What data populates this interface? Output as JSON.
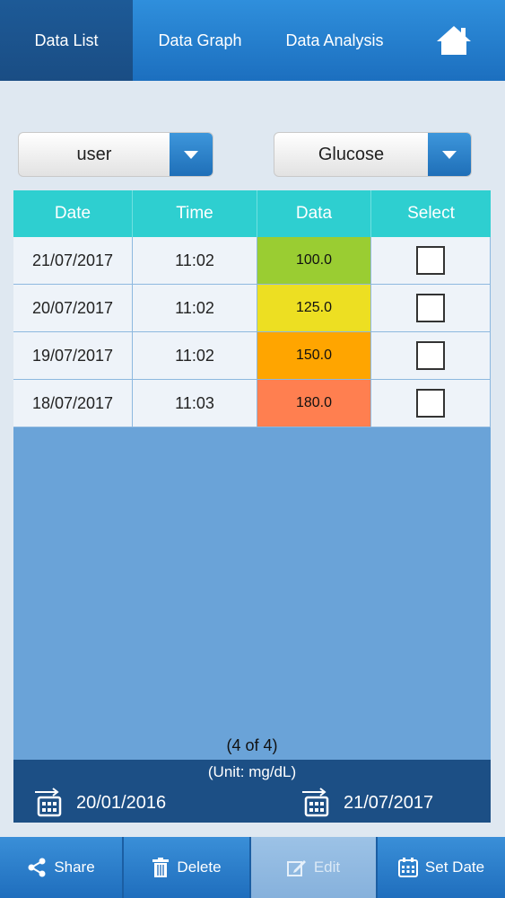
{
  "nav": {
    "tabs": [
      {
        "label": "Data List",
        "active": true
      },
      {
        "label": "Data Graph",
        "active": false
      },
      {
        "label": "Data Analysis",
        "active": false
      }
    ],
    "home_icon": "home-icon"
  },
  "filters": {
    "user": "user",
    "measure": "Glucose"
  },
  "table": {
    "headers": [
      "Date",
      "Time",
      "Data",
      "Select"
    ],
    "rows": [
      {
        "date": "21/07/2017",
        "time": "11:02",
        "value": "100.0",
        "color": "#9acd32"
      },
      {
        "date": "20/07/2017",
        "time": "11:02",
        "value": "125.0",
        "color": "#eddf22"
      },
      {
        "date": "19/07/2017",
        "time": "11:02",
        "value": "150.0",
        "color": "#ffa500"
      },
      {
        "date": "18/07/2017",
        "time": "11:03",
        "value": "180.0",
        "color": "#ff7f50"
      }
    ]
  },
  "pager": "(4 of 4)",
  "unit": "(Unit: mg/dL)",
  "date_range": {
    "from": "20/01/2016",
    "to": "21/07/2017"
  },
  "bottom": {
    "share": "Share",
    "delete": "Delete",
    "edit": "Edit",
    "set_date": "Set Date"
  }
}
